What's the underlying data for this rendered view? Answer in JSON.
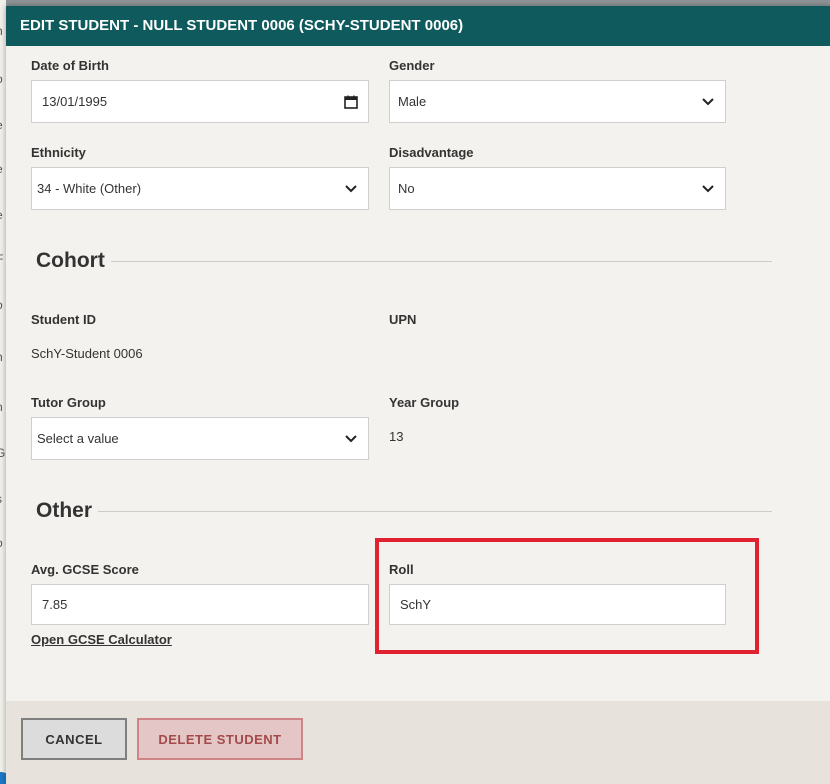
{
  "modal": {
    "title": "EDIT STUDENT - NULL STUDENT 0006 (SCHY-STUDENT 0006)"
  },
  "fields": {
    "dob": {
      "label": "Date of Birth",
      "value": "13/01/1995"
    },
    "gender": {
      "label": "Gender",
      "value": "Male"
    },
    "ethnicity": {
      "label": "Ethnicity",
      "value": "34 - White (Other)"
    },
    "disadvantage": {
      "label": "Disadvantage",
      "value": "No"
    }
  },
  "cohort": {
    "title": "Cohort",
    "student_id": {
      "label": "Student ID",
      "value": "SchY-Student 0006"
    },
    "upn": {
      "label": "UPN",
      "value": ""
    },
    "tutor_group": {
      "label": "Tutor Group",
      "value": "Select a value"
    },
    "year_group": {
      "label": "Year Group",
      "value": "13"
    }
  },
  "other": {
    "title": "Other",
    "gcse": {
      "label": "Avg. GCSE Score",
      "value": "7.85"
    },
    "gcse_link": "Open GCSE Calculator",
    "roll": {
      "label": "Roll",
      "value": "SchY"
    }
  },
  "footer": {
    "cancel_label": "CANCEL",
    "delete_label": "DELETE STUDENT"
  },
  "colors": {
    "header_bg": "#0f5a5c",
    "highlight": "#e0212f",
    "delete_text": "#a34a4a"
  },
  "icons": {
    "calendar": "calendar-icon",
    "dropdown": "chevron-down-icon"
  }
}
